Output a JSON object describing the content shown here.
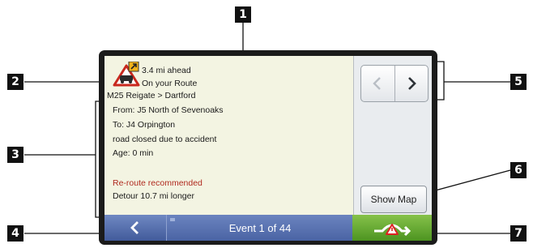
{
  "screen": {
    "alert": {
      "distance": "3.4 mi ahead",
      "position": "On your Route",
      "road": "M25 Reigate > Dartford",
      "from": "From: J5 North of Sevenoaks",
      "to": "To: J4 Orpington",
      "description": "road closed due to accident",
      "age": "Age: 0 min",
      "recommendation": "Re-route recommended",
      "detour": "Detour 10.7 mi longer"
    },
    "side": {
      "show_map_label": "Show Map"
    },
    "bottom": {
      "event_label": "Event 1 of 44"
    }
  },
  "callouts": [
    "1",
    "2",
    "3",
    "4",
    "5",
    "6",
    "7"
  ],
  "icons": {
    "traffic_warning": "traffic-warning-icon",
    "prev": "chevron-left-icon",
    "next": "chevron-right-icon",
    "back": "back-arrow-icon",
    "reroute": "reroute-icon"
  },
  "colors": {
    "panel_bg": "#f3f4e2",
    "bar_blue": "#4a64a4",
    "reroute_green": "#5ea52c",
    "alert_red": "#b02a1f"
  }
}
